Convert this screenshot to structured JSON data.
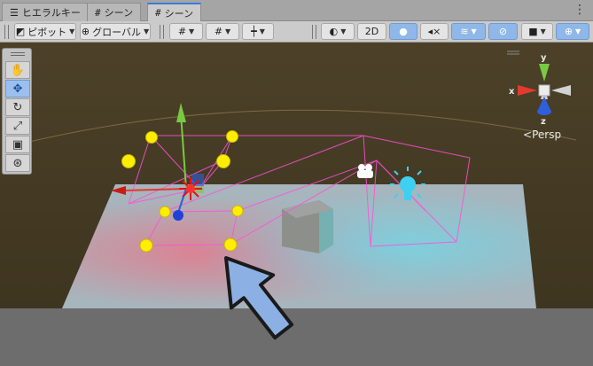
{
  "tabs": [
    {
      "label": "ヒエラルキー",
      "icon": "list-icon",
      "active": false
    },
    {
      "label": "シーン",
      "icon": "grid-icon",
      "active": false
    },
    {
      "label": "シーン",
      "icon": "grid-icon",
      "active": true
    }
  ],
  "toolbar": {
    "pivot_label": "ピボット",
    "global_label": "グローバル",
    "mode_2d_label": "2D"
  },
  "gizmo": {
    "y_label": "y",
    "x_label": "x",
    "z_label": "z",
    "persp_label": "Persp",
    "back_icon": "<"
  },
  "colors": {
    "selected_tool": "#9cc0ee",
    "accent": "#3b7bd8",
    "axis_x": "#e23a2e",
    "axis_y": "#7ac943",
    "axis_z": "#2f5fdc",
    "light_gizmo": "#3ed0f0",
    "handle_yellow": "#ffee00",
    "frustum_magenta": "#ff50d8"
  },
  "palette_tools": [
    "hand-tool",
    "move-tool",
    "rotate-tool",
    "scale-tool",
    "rect-tool",
    "transform-tool"
  ]
}
